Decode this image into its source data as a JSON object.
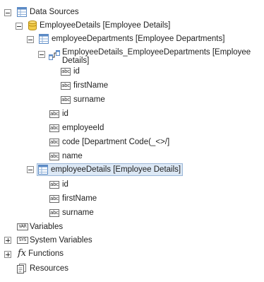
{
  "tree": {
    "data_sources": {
      "label": "Data Sources",
      "icon": "table-icon"
    },
    "employee_details": {
      "label": "EmployeeDetails [Employee Details]",
      "icon": "database-icon"
    },
    "employee_departments": {
      "label": "employeeDepartments [Employee Departments]",
      "icon": "table-icon"
    },
    "relation": {
      "label": "EmployeeDetails_EmployeeDepartments [Employee Details]",
      "icon": "relation-icon",
      "fields": [
        {
          "label": "id",
          "icon": "string-field-icon"
        },
        {
          "label": "firstName",
          "icon": "string-field-icon"
        },
        {
          "label": "surname",
          "icon": "string-field-icon"
        }
      ]
    },
    "department_fields": [
      {
        "label": "id",
        "icon": "string-field-icon"
      },
      {
        "label": "employeeId",
        "icon": "string-field-icon"
      },
      {
        "label": "code [Department Code(_<>/]",
        "icon": "string-field-icon"
      },
      {
        "label": "name",
        "icon": "string-field-icon"
      }
    ],
    "employee_details_table": {
      "label": "employeeDetails [Employee Details]",
      "icon": "table-icon",
      "selected": true,
      "fields": [
        {
          "label": "id",
          "icon": "string-field-icon"
        },
        {
          "label": "firstName",
          "icon": "string-field-icon"
        },
        {
          "label": "surname",
          "icon": "string-field-icon"
        }
      ]
    },
    "variables": {
      "label": "Variables",
      "icon": "variable-icon"
    },
    "system_variables": {
      "label": "System Variables",
      "icon": "system-variable-icon"
    },
    "functions": {
      "label": "Functions",
      "icon": "function-icon",
      "glyph": "fx"
    },
    "resources": {
      "label": "Resources",
      "icon": "resource-icon"
    }
  },
  "field_icon_text": "abc",
  "variable_icon_text": "VAR",
  "system_variable_icon_text": "SYS",
  "colors": {
    "selection_fill": "#dce8f5",
    "selection_border": "#9bb7d8",
    "table_icon": "#5b8ac5",
    "database_icon": "#e0b428"
  }
}
